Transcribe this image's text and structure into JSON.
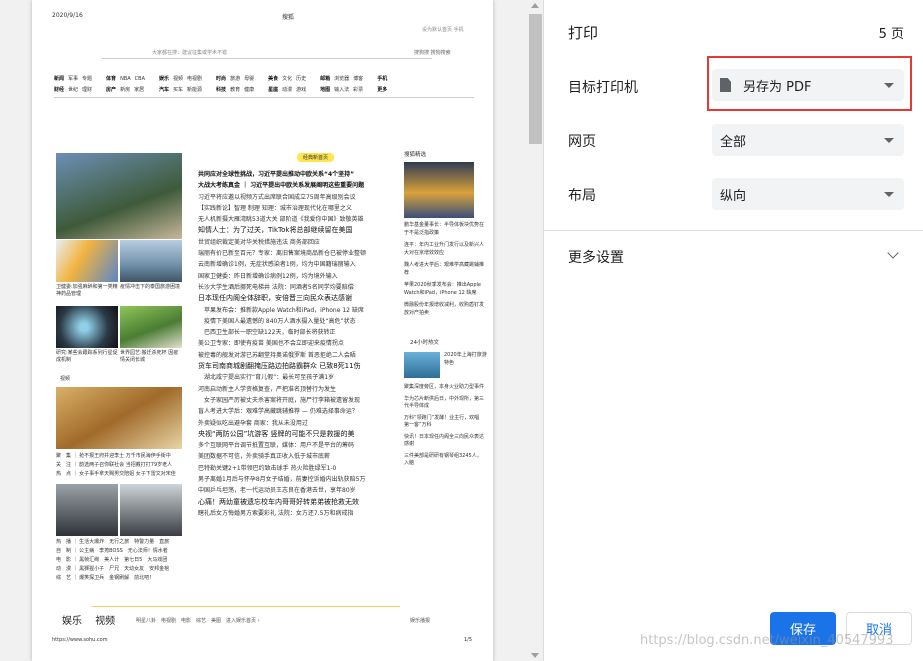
{
  "preview": {
    "date": "2020/9/16",
    "title": "搜狐",
    "top_links": "设为默认首页  手机",
    "search_text": "大家都在搜：建议征集或学术不错",
    "search_btns": "搜狗搜    搜狗搜索",
    "nav": [
      {
        "r1": [
          "新闻",
          "军事",
          "专题"
        ],
        "r2": [
          "财经",
          "世纪",
          "理财"
        ]
      },
      {
        "r1": [
          "体育",
          "NBA",
          "CBA"
        ],
        "r2": [
          "房产",
          "新房",
          "家居"
        ]
      },
      {
        "r1": [
          "娱乐",
          "视频",
          "电视剧"
        ],
        "r2": [
          "汽车",
          "买车",
          "新能源"
        ]
      },
      {
        "r1": [
          "时尚",
          "旅游",
          "母婴"
        ],
        "r2": [
          "科技",
          "教育",
          "健康"
        ]
      },
      {
        "r1": [
          "美食",
          "文化",
          "历史"
        ],
        "r2": [
          "星座",
          "动漫",
          "游戏"
        ]
      },
      {
        "r1": [
          "邮箱",
          "浏览器",
          "博客"
        ],
        "r2": [
          "地图",
          "输入法",
          "彩票"
        ]
      },
      {
        "r1": [
          "手机"
        ],
        "r2": [
          "更多"
        ]
      }
    ],
    "badge": "经典新首页",
    "captions": {
      "c1": "卫健委:加强麻醉和第一类精神药品管理",
      "c2": "疫情冲击下的泰国旅游困境",
      "c3": "研究:某些会跟踪系列行星促成机制",
      "c4": "世界园艺:搬迁杀死杯 因疫情关闭长城",
      "video": "视频"
    },
    "news": [
      {
        "text": "共同应对全球性挑战，习近平提出推动中欧关系“4个坚持”",
        "style": "hl"
      },
      {
        "text": "大战大考练真金 ｜ 习近平提出中欧关系发展阐明这些重要问题",
        "style": "hl"
      },
      {
        "text": "习近平将应邀以视频方式出席联合国成立75周年高级别会议",
        "style": ""
      },
      {
        "text": "【实践新论】智理 制理 知理：城市治理现代化在哪里之义",
        "style": ""
      },
      {
        "text": "无人机新摄大雁湾眺53道大关 部阶道《我爱你中国》致敬英雄",
        "style": ""
      },
      {
        "text": "知情人士：为了过关，TikTok将总部继续留在美国",
        "style": "big"
      },
      {
        "text": "世贸组织裁定美对华关税措施违法 商务部回应",
        "style": ""
      },
      {
        "text": "瑞丽有价已新至百元？专家：离旧售案境商品新仓已被停业整顿",
        "style": ""
      },
      {
        "text": "云南新增确诊1例，无症状感染者1例，均为中国籍瑞丽输入",
        "style": ""
      },
      {
        "text": "国家卫健委：昨日新增确诊病例12例，均为境外输入",
        "style": ""
      },
      {
        "text": "长沙大学生酒后挪死电梯井 法院：同酒者5名同学均要赔偿",
        "style": ""
      },
      {
        "text": "日本现任内阁全体辞职，安倍晋三向民众表达感谢",
        "style": "big"
      },
      {
        "text": "　苹果发布会：推新款Apple Watch和iPad，iPhone 12 缺席",
        "style": ""
      },
      {
        "text": "　疫情下美国人最遗憾的 840万人酒水摄入量处“高危”状态",
        "style": ""
      },
      {
        "text": "　巴西卫生部长一职空缺122天，临时部长将获转正",
        "style": ""
      },
      {
        "text": "美公卫专家：即使有疫苗 美国也不会立即迎来疫情拐点",
        "style": ""
      },
      {
        "text": "被控毒的舰发对游已苏翻堂持奥诺俄罗斯 首恶拒绝二人会晤",
        "style": ""
      },
      {
        "text": "货车司南商城剧翻掩压路边拍路霸群众 已致8死11伤",
        "style": "big"
      },
      {
        "text": "　湖北咸宁提出实行“育儿假”：最长可至孩子满1岁",
        "style": ""
      },
      {
        "text": "河南启动新主人学资格复查，严把准名顶替行为发生",
        "style": ""
      },
      {
        "text": "　女子家园严厉被丈夫杀害案将开庭，施尸行李箱被遗留发现",
        "style": ""
      },
      {
        "text": "盲人考进大学后：艰难学高藏跳辅推荐 — 仍难选择事命运？",
        "style": ""
      },
      {
        "text": "外卖疑似吃出避孕套 商家：我从未没用过",
        "style": ""
      },
      {
        "text": "央视“两防公园”坑游客 竖牌的可能不只是救援的美",
        "style": "big"
      },
      {
        "text": "多个互联网平台调节抵置互联，媒体：用户不是平台的筹码",
        "style": ""
      },
      {
        "text": "美团数据不可信，外卖骑手真正收入低于城市底薪",
        "style": ""
      },
      {
        "text": "巴特勒关键2+1带领巴约致击球手 热火险胜绿军1-0",
        "style": ""
      },
      {
        "text": "男子离婚1月后与怀孕8月女子结婚，前妻控诉婚内出轨获赔5万",
        "style": ""
      },
      {
        "text": "中国乒乓坦荡，老一代运动员王志良在香港去世，享年80岁",
        "style": ""
      },
      {
        "text": "心痛！两幼童被遗忘校车内哥哥好转弟弟被抢救无效",
        "style": "big"
      },
      {
        "text": "瞎礼后女方悔婚男方索要彩礼 法院：女方还7.5万和病戒指",
        "style": ""
      }
    ],
    "right": {
      "head": "搜狐精选",
      "items": [
        "鹏华基金董事长：半导体板块优势在于不是泛指政策",
        "连平：年内工业升门发行以及新兴人大对在京增效效应",
        "魏人考进大学后：艰难学高藏跳辅推荐",
        "苹果2020秋季发布会：推出Apple Watch和iPad，iPhone 12 缺席",
        "微融股份年报增收减利，收购盾钉发放对产拍卖"
      ],
      "hot_head": "24小时热文",
      "hot": [
        "2020年上海打旅游特色",
        "聚集深度旁区，本身火业助力型事件",
        "华为芯片断供后日，中外现所，第三代半导体成",
        "万科“领跑门”发酵！业主行，欢唱第一客”万科",
        "快讯！日本现任内阁全三向民众表达感谢",
        "三件美部是研研有钢琴组3245人，入脑"
      ]
    },
    "list": [
      "聚　集 ｜ 抢不报王府并迎李士 万千市民海伊手街中",
      "关　注 ｜ 韵选两子召你联社会 当招戴打打79岁老人",
      "热　点 ｜ 女子事手拿天赐男交陪姐 女子下雷文对宋佳",
      "热　播 ｜ 生活大爆炸　无行之旅　特警力量　直旅",
      "自　制 ｜ 公主病　李挎BOSS　无心法师！情水者",
      "电　影 ｜ 黑帧汇绚　美人计　第七日5　大马戏团",
      "动　漫 ｜ 黑狮猩小子　尸兄　天幼女友　安邦金棺",
      "综　艺 ｜ 爆笑探卫兵　金钢刷解　前北吧！　"
    ],
    "footer": {
      "tabs": [
        "娱乐",
        "视频"
      ],
      "sub": "明星八卦　电视剧　电影　综艺　美图　进入娱乐首页 ›",
      "right": "娱乐播报",
      "url": "https://www.sohu.com",
      "page": "1/5"
    }
  },
  "settings": {
    "title": "打印",
    "pages": "5 页",
    "destination_label": "目标打印机",
    "destination_value": "另存为 PDF",
    "pages_label": "网页",
    "pages_value": "全部",
    "layout_label": "布局",
    "layout_value": "纵向",
    "more_label": "更多设置",
    "save_label": "保存",
    "cancel_label": "取消"
  },
  "watermark": "https://blog.csdn.net/weixin_40547993",
  "colors": {
    "accent": "#1a73e8",
    "highlight_box": "#e53935"
  }
}
